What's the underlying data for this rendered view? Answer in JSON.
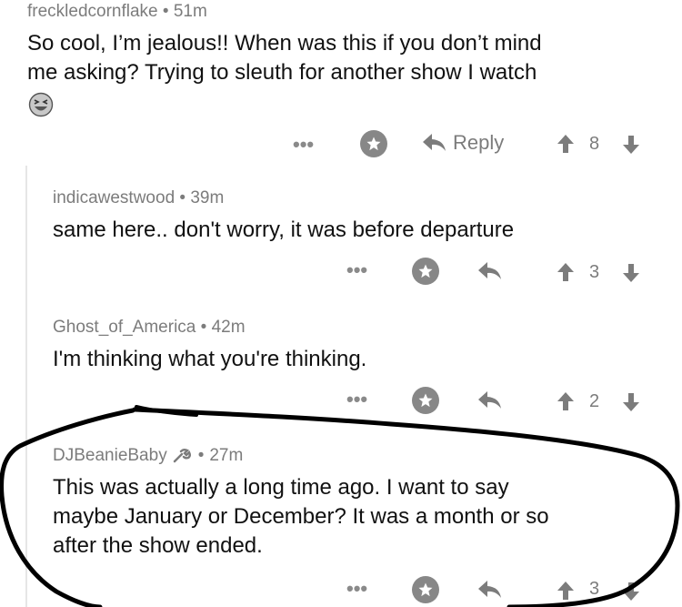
{
  "comments": [
    {
      "author": "freckledcornflake",
      "time": "51m",
      "body_lines": [
        "So cool, I’m jealous!! When was this if you don’t mind",
        "me asking? Trying to sleuth for another show I watch"
      ],
      "reply_label": "Reply",
      "score": "8",
      "emoji_icon": "laughing-face-emoji"
    },
    {
      "author": "indicawestwood",
      "time": "39m",
      "body_lines": [
        "same here.. don't worry, it was before departure"
      ],
      "score": "3"
    },
    {
      "author": "Ghost_of_America",
      "time": "42m",
      "body_lines": [
        "I'm thinking what you're thinking."
      ],
      "score": "2"
    },
    {
      "author": "DJBeanieBaby",
      "time": "27m",
      "author_icon": "wrench-icon",
      "body_lines": [
        "This was actually a long time ago. I want to say",
        "maybe January or December? It was a month or so",
        "after the show ended."
      ],
      "score": "3"
    }
  ],
  "separator": "•",
  "more_label": "•••",
  "colors": {
    "icon": "#878787",
    "meta": "#7c7c7c",
    "annotation": "#000000"
  }
}
